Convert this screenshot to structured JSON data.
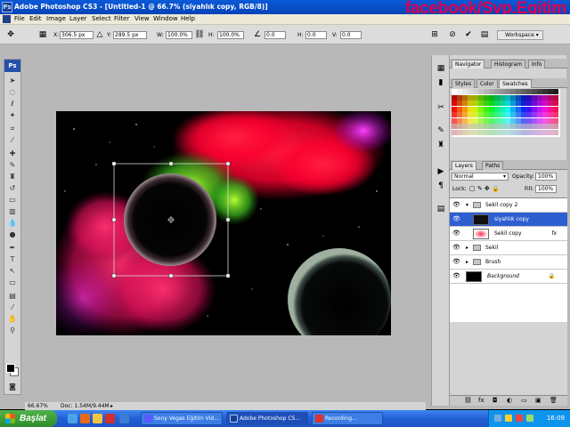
{
  "window": {
    "title": "Adobe Photoshop CS3 - [Untitled-1 @ 66.7% (siyahlık copy, RGB/8)]",
    "watermark": "facebook/Svp.Egitim"
  },
  "menu": {
    "items": [
      "File",
      "Edit",
      "Image",
      "Layer",
      "Select",
      "Filter",
      "View",
      "Window",
      "Help"
    ]
  },
  "options_bar": {
    "x_label": "X:",
    "x_value": "306.5 px",
    "y_label": "Y:",
    "y_value": "289.5 px",
    "w_label": "W:",
    "w_value": "100.0%",
    "h_label": "H:",
    "h_value": "100.0%",
    "angle_value": "0.0",
    "hskew_label": "H:",
    "hskew_value": "0.0",
    "vskew_label": "V:",
    "vskew_value": "0.0",
    "workspace_label": "Workspace"
  },
  "status_bar": {
    "zoom": "66.67%",
    "doc": "Doc: 1.54M/9.44M"
  },
  "panels": {
    "top_tabs": [
      "Navigator",
      "Histogram",
      "Info"
    ],
    "mid_tabs": [
      "Styles",
      "Color",
      "Swatches"
    ],
    "layers_tabs": [
      "Layers",
      "Paths"
    ],
    "blend_mode": "Normal",
    "opacity_label": "Opacity:",
    "opacity_value": "100%",
    "lock_label": "Lock:",
    "fill_label": "Fill:",
    "fill_value": "100%"
  },
  "layers": [
    {
      "name": "Sekil copy 2",
      "type": "group",
      "expanded": true,
      "selected": false,
      "indent": 0
    },
    {
      "name": "siyahlık copy",
      "type": "layer",
      "selected": true,
      "indent": 1
    },
    {
      "name": "Sekil copy",
      "type": "layer",
      "selected": false,
      "fx": "fx",
      "indent": 1
    },
    {
      "name": "Sekil",
      "type": "group",
      "expanded": false,
      "selected": false,
      "indent": 0
    },
    {
      "name": "Brush",
      "type": "group",
      "expanded": false,
      "selected": false,
      "indent": 0
    },
    {
      "name": "Background",
      "type": "background",
      "selected": false,
      "indent": 0
    }
  ],
  "taskbar": {
    "start_label": "Başlat",
    "tasks": [
      "Sony Vegas Eğitim Vid...",
      "Adobe Photoshop CS...",
      "Recording..."
    ],
    "clock": "16:09"
  },
  "colors": {
    "titlebar": "#0643b8",
    "workspace_bg": "#b8b8b8",
    "selected_layer": "#2e5fd1",
    "watermark": "#e0004e"
  }
}
